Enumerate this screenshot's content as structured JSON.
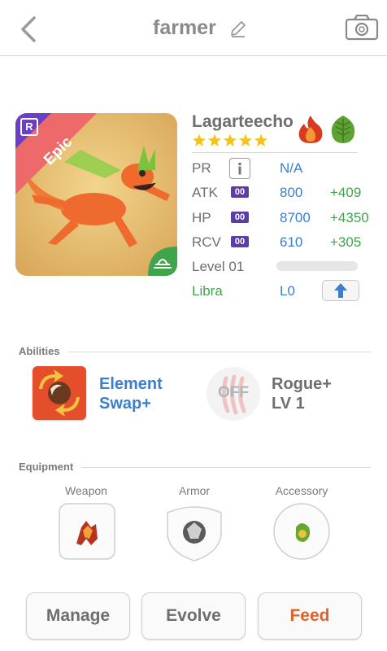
{
  "header": {
    "title": "farmer"
  },
  "monster": {
    "name": "Lagarteecho",
    "rarity": "Epic",
    "rarity_letter": "R",
    "stars": 5,
    "elements": [
      "fire-icon",
      "nature-icon"
    ]
  },
  "stats": [
    {
      "label": "PR",
      "badge": "",
      "value": "N/A",
      "bonus": ""
    },
    {
      "label": "ATK",
      "badge": "00",
      "value": "800",
      "bonus": "+409"
    },
    {
      "label": "HP",
      "badge": "00",
      "value": "8700",
      "bonus": "+4350"
    },
    {
      "label": "RCV",
      "badge": "00",
      "value": "610",
      "bonus": "+305"
    }
  ],
  "level": {
    "label": "Level 01",
    "progress": 0
  },
  "sign": {
    "name": "Libra",
    "level": "L0"
  },
  "abilities": {
    "title": "Abilities",
    "items": [
      {
        "name_line1": "Element",
        "name_line2": "Swap+",
        "state": ""
      },
      {
        "name_line1": "Rogue+",
        "name_line2": "LV 1",
        "state": "OFF"
      }
    ]
  },
  "equipment": {
    "title": "Equipment",
    "slots": [
      {
        "label": "Weapon"
      },
      {
        "label": "Armor"
      },
      {
        "label": "Accessory"
      }
    ]
  },
  "buttons": {
    "manage": "Manage",
    "evolve": "Evolve",
    "feed": "Feed"
  },
  "colors": {
    "accent_blue": "#3a7fd0",
    "bonus_green": "#3fa54b",
    "feed_orange": "#e0632a",
    "epic_ribbon": "#ee6a6a",
    "badge_purple": "#5a3ea6"
  }
}
